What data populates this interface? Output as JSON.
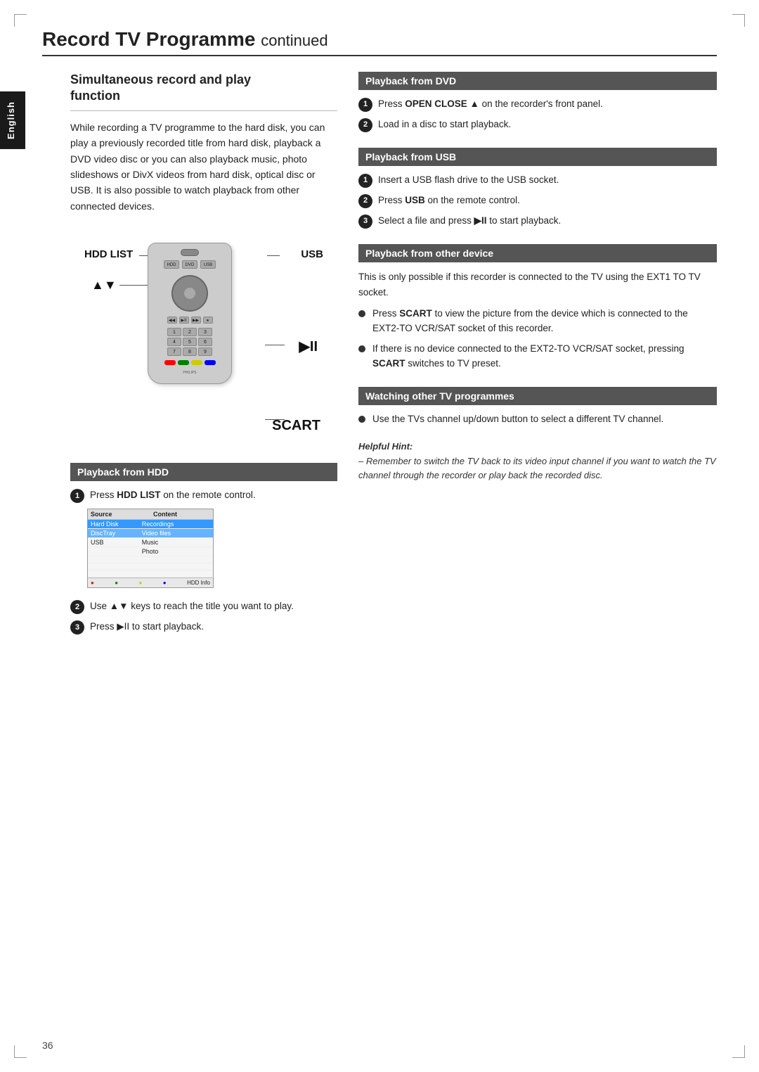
{
  "page": {
    "title": "Record TV Programme",
    "title_continued": "continued",
    "page_number": "36",
    "language_label": "English"
  },
  "left_column": {
    "section_title_line1": "Simultaneous record and play",
    "section_title_line2": "function",
    "body_text": "While recording a TV programme to the hard disk, you can play a previously recorded title from hard disk, playback a DVD video disc or you can also playback music, photo slideshows or DivX videos from hard disk, optical disc or USB.  It is also possible to watch playback from other connected devices.",
    "diagram": {
      "label_hdd": "HDD LIST",
      "label_usb": "USB",
      "label_arrows": "▲▼",
      "label_play": "▶II",
      "label_scart": "SCART"
    },
    "hdd_section": {
      "header": "Playback from HDD",
      "step1": "Press ",
      "step1_bold": "HDD LIST",
      "step1_rest": " on the remote control.",
      "step2": "Use ▲▼ keys to reach the title you want to play.",
      "step3": "Press ▶II to start playback."
    },
    "hdd_table": {
      "col1": "Source",
      "col2": "Content",
      "rows": [
        {
          "col1": "Hard Disk",
          "col2": "Recordings",
          "hl": "hl1"
        },
        {
          "col1": "DiscTray",
          "col2": "Video files",
          "hl": "hl2"
        },
        {
          "col1": "USB",
          "col2": "Music",
          "hl": "none"
        },
        {
          "col1": "",
          "col2": "Photo",
          "hl": "none"
        },
        {
          "col1": "",
          "col2": "",
          "hl": "none"
        },
        {
          "col1": "",
          "col2": "",
          "hl": "none"
        },
        {
          "col1": "",
          "col2": "",
          "hl": "none"
        }
      ],
      "footer": "● ● ● ● HDD Info"
    }
  },
  "right_column": {
    "dvd_section": {
      "header": "Playback from DVD",
      "step1_pre": "Press ",
      "step1_bold": "OPEN CLOSE ▲",
      "step1_post": " on the recorder's front panel.",
      "step2": "Load in a disc to start playback."
    },
    "usb_section": {
      "header": "Playback from USB",
      "step1": "Insert a USB flash drive to the USB socket.",
      "step2_pre": "Press ",
      "step2_bold": "USB",
      "step2_post": " on the remote control.",
      "step3_pre": "Select a file and press ",
      "step3_bold": "▶II",
      "step3_post": " to start playback."
    },
    "other_device_section": {
      "header": "Playback from other device",
      "body": "This is only possible if this recorder is connected to the TV using the EXT1 TO TV socket.",
      "bullet1_pre": "Press ",
      "bullet1_bold": "SCART",
      "bullet1_post": " to view the picture from the device which is connected to the EXT2-TO VCR/SAT socket of this recorder.",
      "bullet2_pre": "If there is no device connected to the EXT2-TO VCR/SAT socket, pressing ",
      "bullet2_bold": "SCART",
      "bullet2_post": " switches to TV preset."
    },
    "watching_section": {
      "header": "Watching other TV programmes",
      "bullet1": "Use the TVs channel up/down button to select a different TV channel."
    },
    "helpful_hint": {
      "title": "Helpful Hint:",
      "text": "– Remember to switch the TV back to its video input channel if you want to watch the TV channel through the recorder or play back the recorded disc."
    }
  }
}
